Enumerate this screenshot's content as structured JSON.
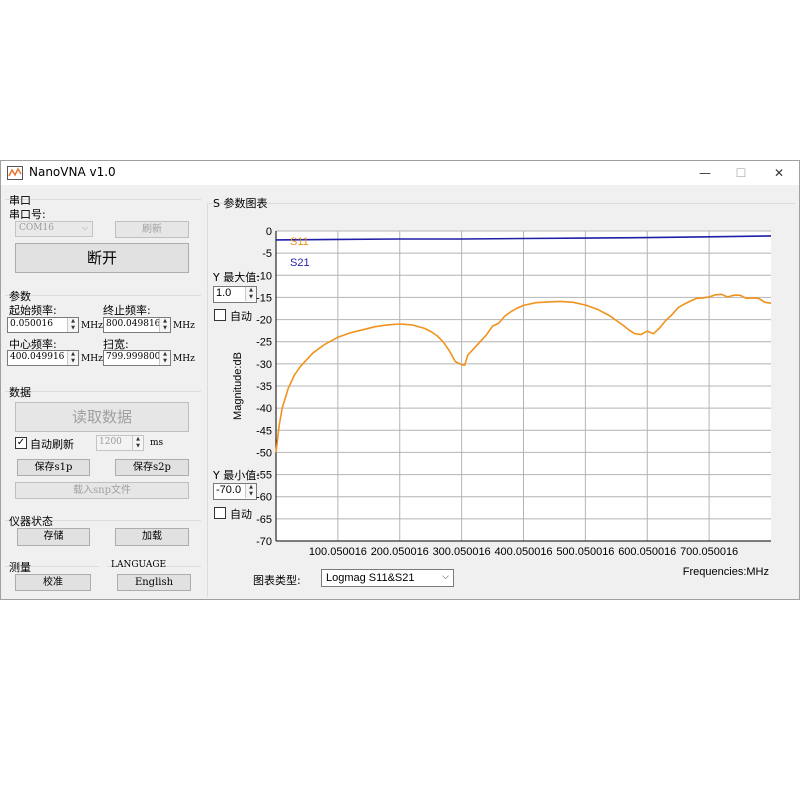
{
  "window": {
    "title": "NanoVNA v1.0",
    "minimize": "—",
    "maximize": "☐",
    "close": "✕"
  },
  "serial": {
    "group_title": "串口",
    "port_label": "串口号:",
    "port_value": "COM16",
    "refresh_label": "刷新",
    "disconnect_label": "断开"
  },
  "params": {
    "group_title": "参数",
    "start_label": "起始频率:",
    "start_value": "0.050016",
    "stop_label": "终止频率:",
    "stop_value": "800.049816",
    "center_label": "中心频率:",
    "center_value": "400.049916",
    "span_label": "扫宽:",
    "span_value": "799.999800",
    "unit": "MHz"
  },
  "data_group": {
    "group_title": "数据",
    "read_label": "读取数据",
    "auto_refresh_label": "自动刷新",
    "auto_refresh_checked": true,
    "interval_value": "1200",
    "interval_unit": "ms",
    "save_s1p_label": "保存s1p",
    "save_s2p_label": "保存s2p",
    "load_snp_label": "载入snp文件"
  },
  "instrument": {
    "group_title": "仪器状态",
    "store_label": "存储",
    "load_label": "加载"
  },
  "measure": {
    "group_title": "测量",
    "calibrate_label": "校准"
  },
  "language": {
    "group_title": "LANGUAGE",
    "value": "English"
  },
  "chart_panel": {
    "group_title": "S 参数图表",
    "y_max_label": "Y 最大值:",
    "y_max_value": "1.0",
    "y_min_label": "Y 最小值:",
    "y_min_value": "-70.0",
    "auto_label": "自动",
    "chart_type_label": "图表类型:",
    "chart_type_value": "Logmag S11&S21"
  },
  "chart_data": {
    "type": "line",
    "ylabel": "Magnitude:dB",
    "xlabel": "Frequencies:MHz",
    "ylim": [
      -70,
      0
    ],
    "xlim": [
      0.050016,
      800.049816
    ],
    "y_ticks": [
      0,
      -5,
      -10,
      -15,
      -20,
      -25,
      -30,
      -35,
      -40,
      -45,
      -50,
      -55,
      -60,
      -65,
      -70
    ],
    "x_ticks": [
      100.050016,
      200.050016,
      300.050016,
      400.050016,
      500.050016,
      600.050016,
      700.050016
    ],
    "x_tick_labels": [
      "100.050016",
      "200.050016",
      "300.050016",
      "400.050016",
      "500.050016",
      "600.050016",
      "700.050016"
    ],
    "grid": true,
    "legend": "top-left",
    "series": [
      {
        "name": "S11",
        "color": "#f0921c",
        "x": [
          0,
          5,
          10,
          20,
          30,
          40,
          60,
          80,
          100,
          120,
          140,
          160,
          180,
          200,
          220,
          240,
          250,
          260,
          270,
          280,
          290,
          300,
          305,
          310,
          320,
          330,
          340,
          350,
          360,
          370,
          380,
          390,
          400,
          420,
          440,
          460,
          480,
          500,
          520,
          540,
          560,
          570,
          580,
          590,
          600,
          610,
          620,
          630,
          640,
          650,
          660,
          670,
          680,
          690,
          700,
          710,
          720,
          730,
          740,
          750,
          760,
          770,
          780,
          790,
          800
        ],
        "y": [
          -50,
          -44,
          -40,
          -35.5,
          -32.5,
          -30.5,
          -27.5,
          -25.5,
          -24,
          -23,
          -22.3,
          -21.6,
          -21.2,
          -21,
          -21.2,
          -22,
          -22.7,
          -23.6,
          -25,
          -27,
          -29.5,
          -30.2,
          -30.3,
          -28,
          -26.5,
          -25,
          -23.5,
          -21.5,
          -20.8,
          -19.2,
          -18.2,
          -17.4,
          -16.8,
          -16.2,
          -16,
          -15.9,
          -16.1,
          -16.7,
          -17.7,
          -19.2,
          -21.2,
          -22.3,
          -23.2,
          -23.4,
          -22.6,
          -23.2,
          -21.9,
          -20.2,
          -18.9,
          -17.3,
          -16.5,
          -15.8,
          -15.2,
          -15.1,
          -14.9,
          -14.4,
          -14.3,
          -14.9,
          -14.5,
          -14.5,
          -15.2,
          -15.1,
          -15.2,
          -16.1,
          -16.3
        ]
      },
      {
        "name": "S21",
        "color": "#1f1fa8",
        "x": [
          0,
          100,
          200,
          300,
          400,
          500,
          600,
          700,
          800
        ],
        "y": [
          -2.0,
          -1.9,
          -1.8,
          -1.8,
          -1.7,
          -1.6,
          -1.5,
          -1.3,
          -1.1
        ]
      }
    ]
  }
}
